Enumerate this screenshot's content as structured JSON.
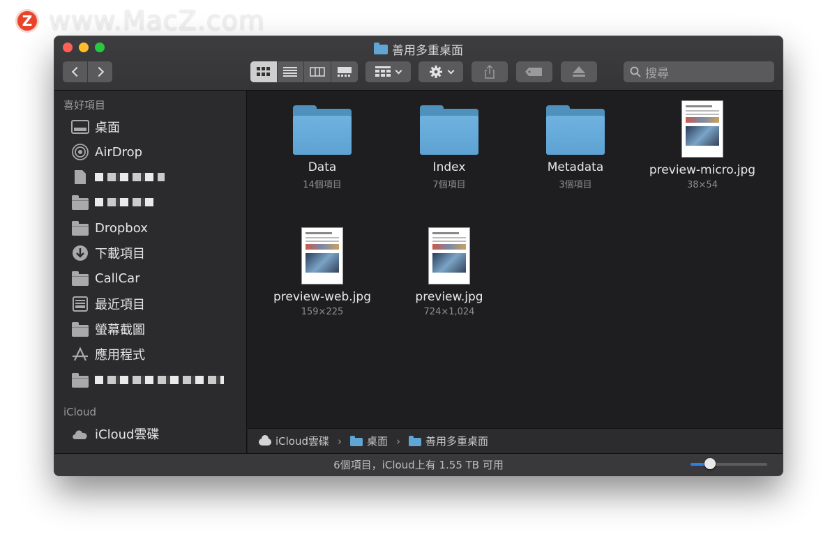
{
  "watermark": {
    "logo_letter": "Z",
    "text": "www.MacZ.com"
  },
  "window": {
    "title": "善用多重桌面"
  },
  "toolbar": {
    "back_icon": "chevron-left-icon",
    "forward_icon": "chevron-right-icon",
    "views": [
      "icon-view-icon",
      "list-view-icon",
      "column-view-icon",
      "gallery-view-icon"
    ],
    "active_view": 0,
    "search_placeholder": "搜尋"
  },
  "sidebar": {
    "favorites_header": "喜好項目",
    "items": [
      {
        "label": "桌面",
        "icon": "desktop-icon"
      },
      {
        "label": "AirDrop",
        "icon": "airdrop-icon"
      },
      {
        "label": "",
        "icon": "document-icon"
      },
      {
        "label": "",
        "icon": "folder-icon"
      },
      {
        "label": "Dropbox",
        "icon": "folder-icon"
      },
      {
        "label": "下載項目",
        "icon": "download-icon"
      },
      {
        "label": "CallCar",
        "icon": "folder-icon"
      },
      {
        "label": "最近項目",
        "icon": "recents-icon"
      },
      {
        "label": "螢幕截圖",
        "icon": "folder-icon"
      },
      {
        "label": "應用程式",
        "icon": "applications-icon"
      },
      {
        "label": "",
        "icon": "folder-icon"
      }
    ],
    "icloud_header": "iCloud",
    "icloud_items": [
      {
        "label": "iCloud雲碟",
        "icon": "cloud-icon"
      }
    ]
  },
  "files": [
    {
      "name": "Data",
      "meta": "14個項目",
      "kind": "folder"
    },
    {
      "name": "Index",
      "meta": "7個項目",
      "kind": "folder"
    },
    {
      "name": "Metadata",
      "meta": "3個項目",
      "kind": "folder"
    },
    {
      "name": "preview-micro.jpg",
      "meta": "38×54",
      "kind": "image"
    },
    {
      "name": "preview-web.jpg",
      "meta": "159×225",
      "kind": "image"
    },
    {
      "name": "preview.jpg",
      "meta": "724×1,024",
      "kind": "image"
    }
  ],
  "pathbar": {
    "crumbs": [
      "iCloud雲碟",
      "桌面",
      "善用多重桌面"
    ]
  },
  "statusbar": {
    "text": "6個項目，iCloud上有 1.55 TB 可用",
    "zoom_level": 0.25
  },
  "colors": {
    "accent": "#2f7ee6",
    "folder": "#5fa6d4",
    "window_bg": "#1e1e20",
    "sidebar_bg": "#2b2b2d"
  }
}
